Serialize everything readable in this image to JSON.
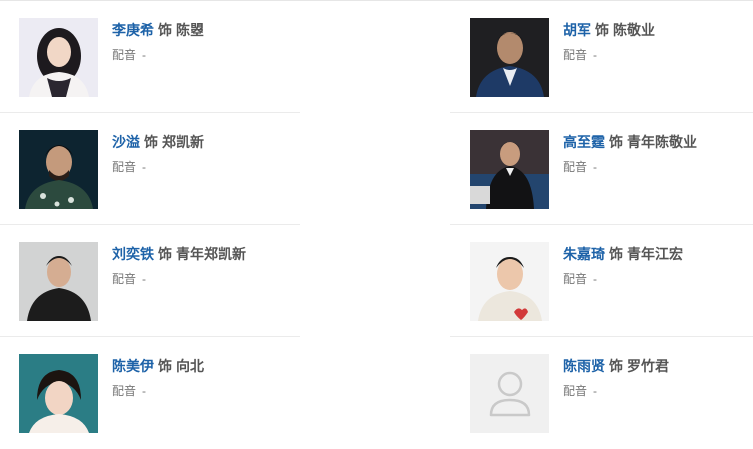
{
  "cast": [
    {
      "left": {
        "actor": "李庚希",
        "as_word": "饰",
        "role": "陈曌",
        "voice_label": "配音",
        "voice_value": "-"
      },
      "right": {
        "actor": "胡军",
        "as_word": "饰",
        "role": "陈敬业",
        "voice_label": "配音",
        "voice_value": "-"
      }
    },
    {
      "left": {
        "actor": "沙溢",
        "as_word": "饰",
        "role": "郑凯新",
        "voice_label": "配音",
        "voice_value": "-"
      },
      "right": {
        "actor": "高至霆",
        "as_word": "饰",
        "role": "青年陈敬业",
        "voice_label": "配音",
        "voice_value": "-"
      }
    },
    {
      "left": {
        "actor": "刘奕铁",
        "as_word": "饰",
        "role": "青年郑凯新",
        "voice_label": "配音",
        "voice_value": "-"
      },
      "right": {
        "actor": "朱嘉琦",
        "as_word": "饰",
        "role": "青年江宏",
        "voice_label": "配音",
        "voice_value": "-"
      }
    },
    {
      "left": {
        "actor": "陈美伊",
        "as_word": "饰",
        "role": "向北",
        "voice_label": "配音",
        "voice_value": "-"
      },
      "right": {
        "actor": "陈雨贤",
        "as_word": "饰",
        "role": "罗竹君",
        "voice_label": "配音",
        "voice_value": "-"
      }
    }
  ],
  "colors": {
    "actor_link": "#1d62a8",
    "text_dark": "#555555",
    "text_muted": "#777777",
    "divider": "#ebebeb"
  }
}
